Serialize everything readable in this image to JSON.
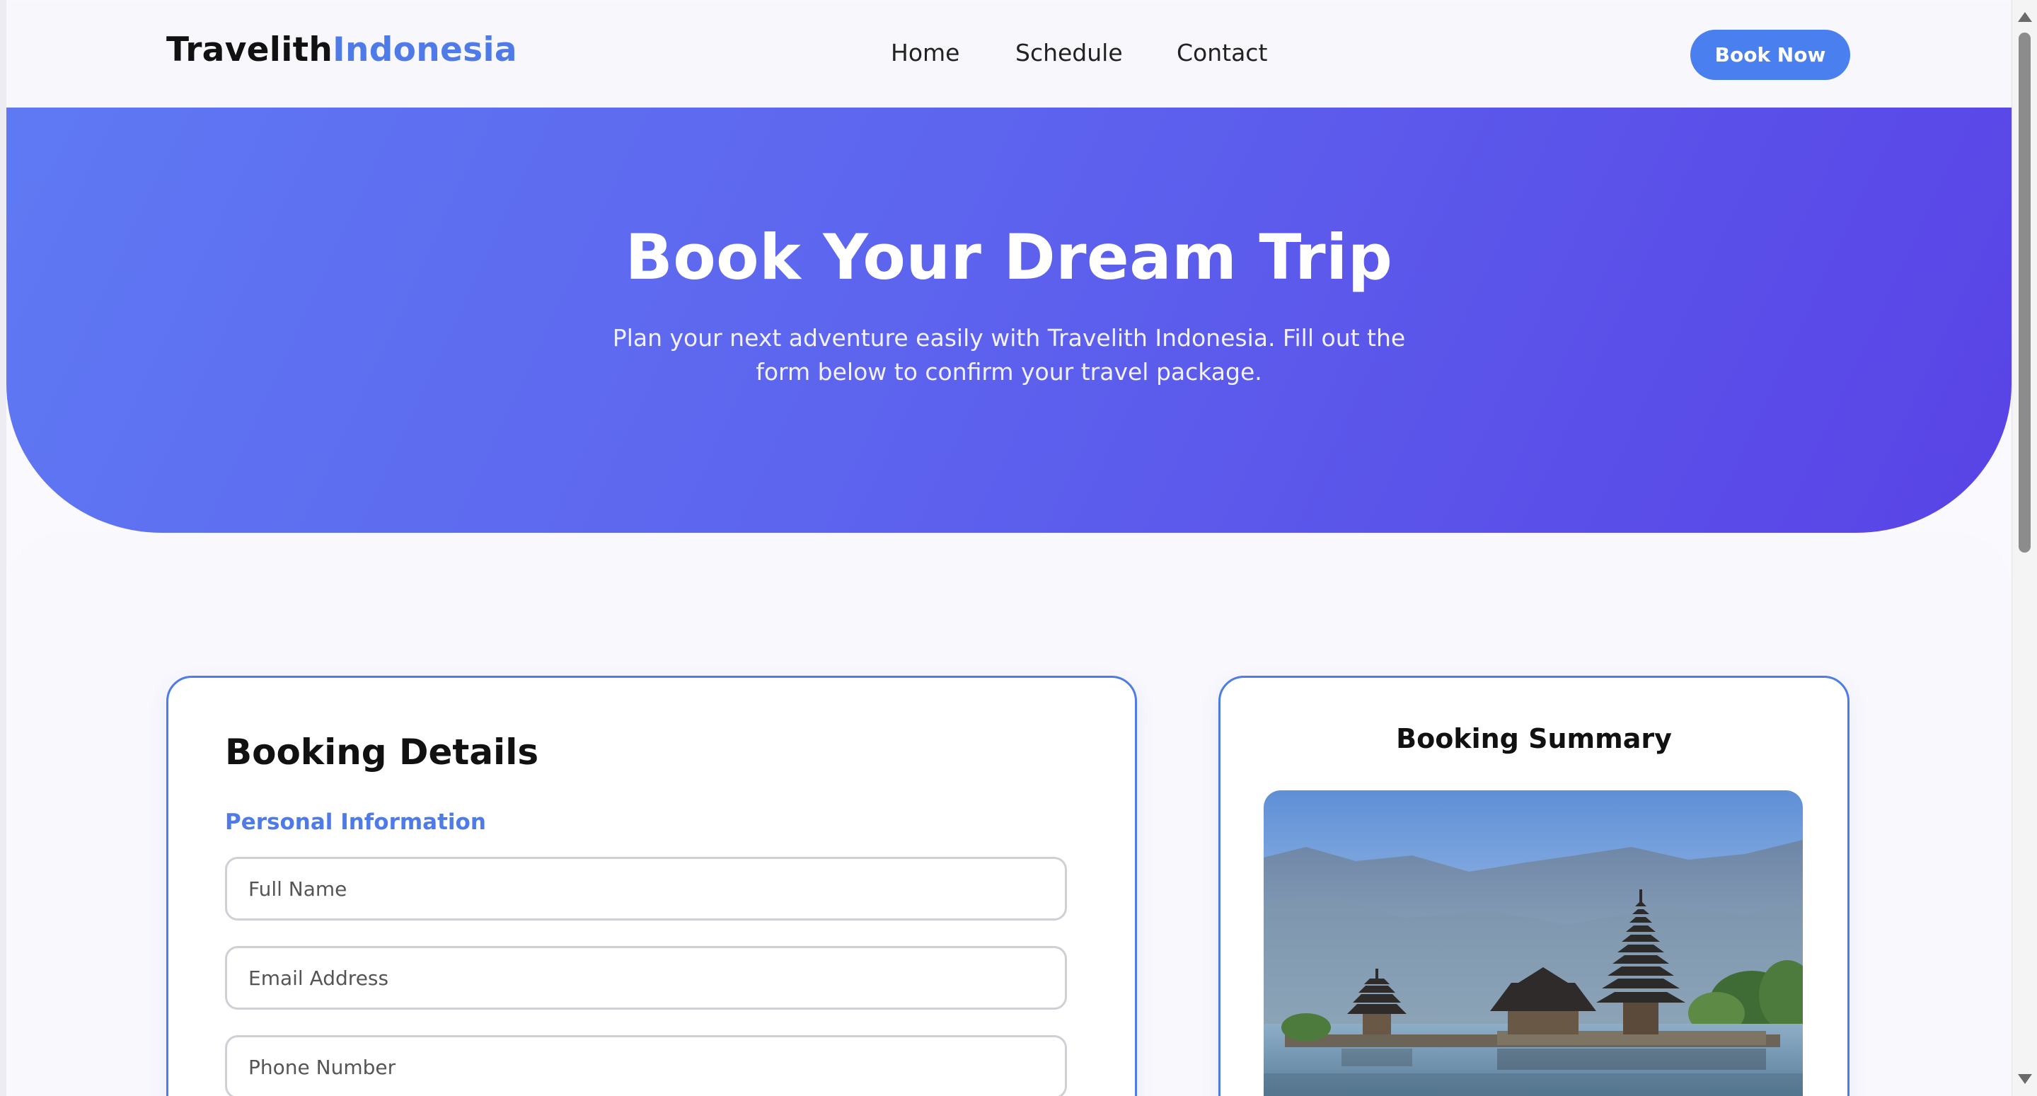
{
  "brand": {
    "name_main": "Travelith",
    "name_accent": "Indonesia",
    "accent_color": "#4f7be8"
  },
  "nav": {
    "links": [
      "Home",
      "Schedule",
      "Contact"
    ],
    "cta_label": "Book Now"
  },
  "hero": {
    "title": "Book Your Dream Trip",
    "subtitle": "Plan your next adventure easily with Travelith Indonesia. Fill out the form below to confirm your travel package.",
    "gradient_colors": [
      "#5f79f3",
      "#5943e6"
    ]
  },
  "booking_form": {
    "title": "Booking Details",
    "section_label": "Personal Information",
    "fields": [
      {
        "name": "full_name",
        "placeholder": "Full Name",
        "value": ""
      },
      {
        "name": "email",
        "placeholder": "Email Address",
        "value": ""
      },
      {
        "name": "phone",
        "placeholder": "Phone Number",
        "value": ""
      }
    ]
  },
  "summary": {
    "title": "Booking Summary",
    "image_subject": "temple-on-lake-photo"
  },
  "icons": {
    "scroll_up": "chevron-up-icon",
    "scroll_down": "chevron-down-icon"
  }
}
